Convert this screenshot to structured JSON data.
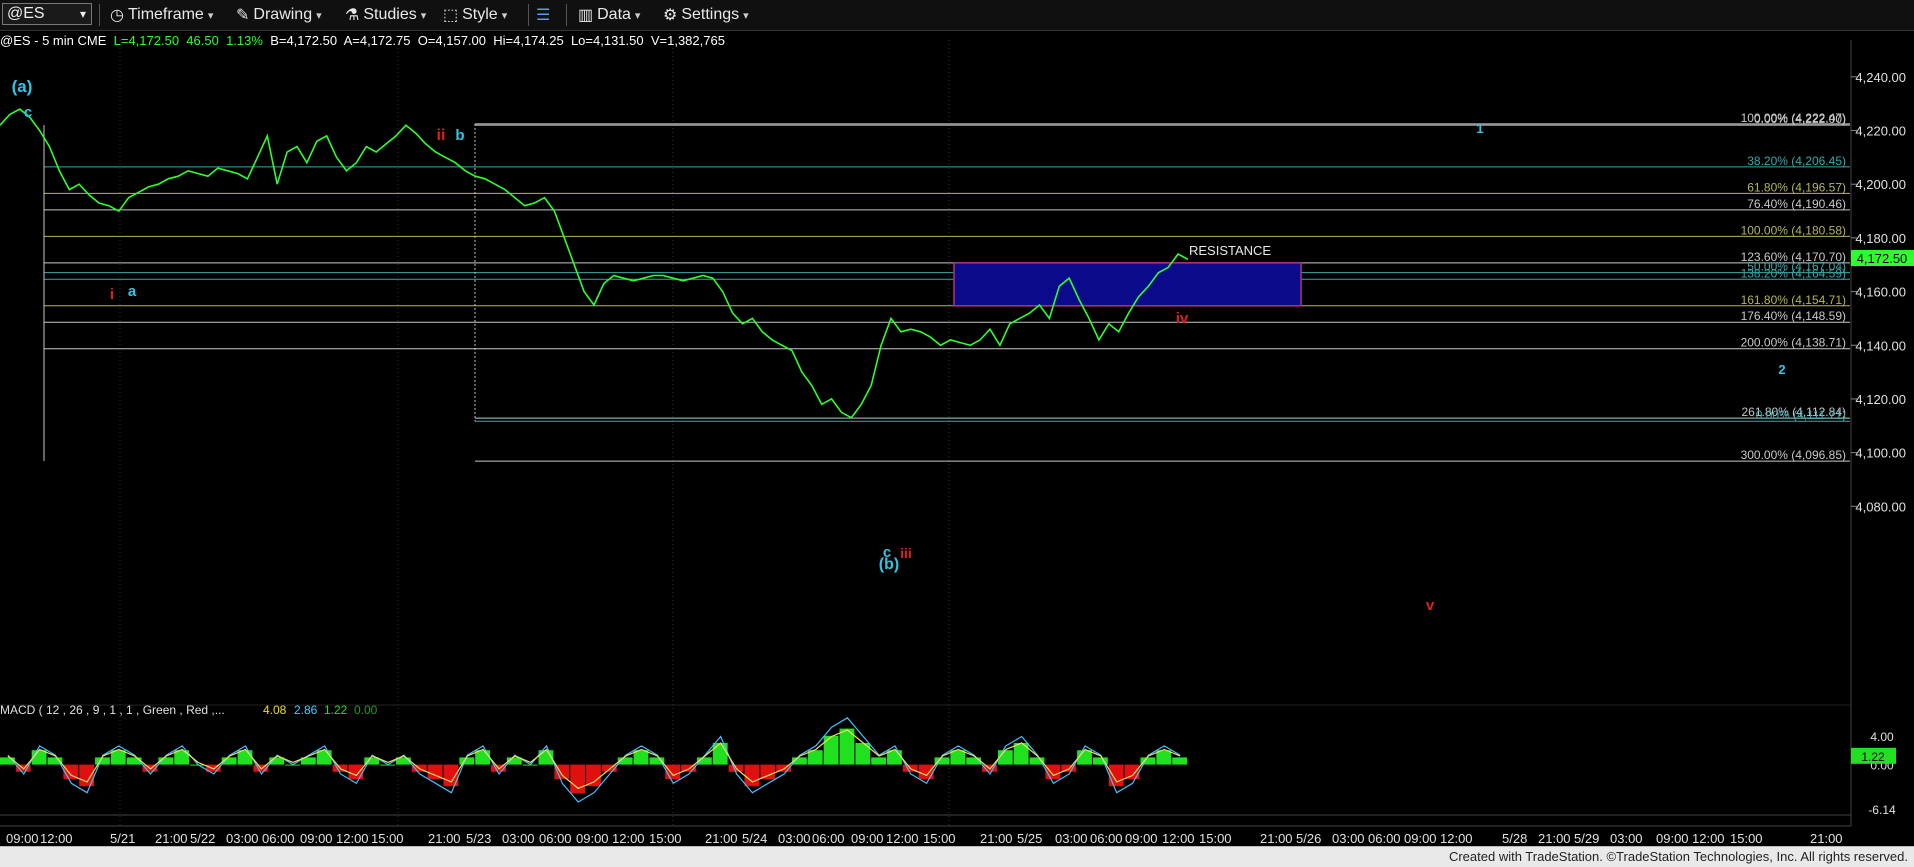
{
  "toolbar": {
    "symbol": "@ES",
    "timeframe": "Timeframe",
    "drawing": "Drawing",
    "studies": "Studies",
    "style": "Style",
    "data": "Data",
    "settings": "Settings"
  },
  "quote": {
    "symbol_line": "@ES - 5 min  CME",
    "last": "L=4,172.50",
    "change": "46.50",
    "pct": "1.13%",
    "bid": "B=4,172.50",
    "ask": "A=4,172.75",
    "open": "O=4,157.00",
    "high": "Hi=4,174.25",
    "low": "Lo=4,131.50",
    "volume": "V=1,382,765"
  },
  "macd_label": {
    "params": "MACD ( 12 , 26 , 9 , 1 , 1 , Green , Red ,...",
    "v1": "4.08",
    "v2": "2.86",
    "v3": "1.22",
    "v4": "0.00"
  },
  "footer": "Created with TradeStation. ©TradeStation Technologies, Inc. All rights reserved.",
  "colors": {
    "price": "#2dff2d",
    "red_label": "#e02020",
    "cyan_label": "#2fc6e8",
    "box_fill": "#0a0a8a",
    "box_border": "#b0327a",
    "macd_bars_pos": "#20e020",
    "macd_bars_neg": "#e01010",
    "last_price_tag": "#2dff2d"
  },
  "chart_data": {
    "type": "line",
    "title": "@ES - 5 min",
    "ylim": [
      4060,
      4250
    ],
    "yticks": [
      "4,240.00",
      "4,220.00",
      "4,200.00",
      "4,180.00",
      "4,160.00",
      "4,140.00",
      "4,120.00",
      "4,100.00",
      "4,080.00"
    ],
    "ytick_values": [
      4240,
      4220,
      4200,
      4180,
      4160,
      4140,
      4120,
      4100,
      4080
    ],
    "last_price": "4,172.50",
    "last_price_value": 4172.5,
    "xticks": [
      "09:00",
      "12:00",
      "5/21",
      "21:00",
      "5/22",
      "03:00",
      "06:00",
      "09:00",
      "12:00",
      "15:00",
      "21:00",
      "5/23",
      "03:00",
      "06:00",
      "09:00",
      "12:00",
      "15:00",
      "21:00",
      "5/24",
      "03:00",
      "06:00",
      "09:00",
      "12:00",
      "15:00",
      "21:00",
      "5/25",
      "03:00",
      "06:00",
      "09:00",
      "12:00",
      "15:00",
      "21:00",
      "5/26",
      "03:00",
      "06:00",
      "09:00",
      "12:00",
      "5/28",
      "21:00",
      "5/29",
      "03:00",
      "09:00",
      "12:00",
      "15:00",
      "21:00"
    ],
    "series": [
      {
        "values": [
          4222,
          4226,
          4228,
          4225,
          4220,
          4214,
          4205,
          4198,
          4200,
          4196,
          4193,
          4192,
          4190,
          4195,
          4197,
          4199,
          4200,
          4202,
          4203,
          4205,
          4204,
          4203,
          4206,
          4205,
          4204,
          4202,
          4210,
          4218,
          4200,
          4212,
          4214,
          4208,
          4216,
          4218,
          4210,
          4205,
          4208,
          4214,
          4212,
          4215,
          4218,
          4222,
          4219,
          4215,
          4212,
          4210,
          4208,
          4205,
          4203,
          4202,
          4200,
          4198,
          4195,
          4192,
          4193,
          4195,
          4190,
          4180,
          4170,
          4160,
          4155,
          4163,
          4166,
          4165,
          4164,
          4165,
          4166,
          4166,
          4165,
          4164,
          4165,
          4166,
          4165,
          4160,
          4152,
          4148,
          4150,
          4145,
          4142,
          4140,
          4138,
          4130,
          4125,
          4118,
          4120,
          4115,
          4113,
          4118,
          4125,
          4140,
          4150,
          4145,
          4146,
          4145,
          4143,
          4140,
          4142,
          4141,
          4140,
          4142,
          4146,
          4140,
          4148,
          4150,
          4152,
          4155,
          4150,
          4162,
          4165,
          4157,
          4150,
          4142,
          4148,
          4145,
          4152,
          4158,
          4162,
          4167,
          4169,
          4174,
          4172
        ]
      }
    ],
    "fib_levels": [
      {
        "label": "100.00% (4,222.47)",
        "value": 4222.47
      },
      {
        "label": "0.00% (4,222.00)",
        "value": 4222.0
      },
      {
        "label": "38.20% (4,206.45)",
        "value": 4206.45
      },
      {
        "label": "61.80% (4,196.57)",
        "value": 4196.57
      },
      {
        "label": "76.40% (4,190.46)",
        "value": 4190.46
      },
      {
        "label": "100.00% (4,180.58)",
        "value": 4180.58
      },
      {
        "label": "123.60% (4,170.70)",
        "value": 4170.7
      },
      {
        "label": "50.00% (4,167.04)",
        "value": 4167.04
      },
      {
        "label": "138.20% (4,164.59)",
        "value": 4164.59
      },
      {
        "label": "161.80% (4,154.71)",
        "value": 4154.71
      },
      {
        "label": "176.40% (4,148.59)",
        "value": 4148.59
      },
      {
        "label": "200.00% (4,138.71)",
        "value": 4138.71
      },
      {
        "label": "261.80% (4,112.84)",
        "value": 4112.84
      },
      {
        "label": "0.00% (4,111.71)",
        "value": 4111.71
      },
      {
        "label": "300.00% (4,096.85)",
        "value": 4096.85
      }
    ],
    "resistance_zone": {
      "label": "RESISTANCE",
      "low": 4154.7,
      "high": 4170.7
    },
    "wave_labels": [
      {
        "text": "(a)",
        "color": "cyan"
      },
      {
        "text": "c",
        "color": "cyan"
      },
      {
        "text": "i",
        "color": "red"
      },
      {
        "text": "a",
        "color": "cyan"
      },
      {
        "text": "ii",
        "color": "red"
      },
      {
        "text": "b",
        "color": "cyan"
      },
      {
        "text": "c",
        "color": "cyan"
      },
      {
        "text": "(b)",
        "color": "cyan"
      },
      {
        "text": "iii",
        "color": "red"
      },
      {
        "text": "iv",
        "color": "red"
      },
      {
        "text": "1",
        "color": "cyan"
      },
      {
        "text": "2",
        "color": "cyan"
      },
      {
        "text": "v",
        "color": "red"
      }
    ],
    "macd": {
      "yticks": [
        "4.00",
        "0.00",
        "-6.14"
      ],
      "ytick_values": [
        4.0,
        0.0,
        -6.14
      ],
      "current": "1.22",
      "current_value": 1.22,
      "hist": [
        1,
        -1,
        2,
        1,
        -2,
        -3,
        1,
        2,
        1,
        -1,
        1,
        2,
        0,
        -1,
        1,
        2,
        -1,
        1,
        0,
        1,
        2,
        -1,
        -2,
        1,
        0,
        1,
        -1,
        -2,
        -3,
        1,
        2,
        -1,
        1,
        0,
        2,
        -2,
        -4,
        -3,
        -1,
        1,
        2,
        1,
        -2,
        -1,
        1,
        3,
        -1,
        -3,
        -2,
        -1,
        1,
        2,
        4,
        5,
        3,
        1,
        2,
        -1,
        -2,
        1,
        2,
        1,
        -1,
        2,
        3,
        1,
        -2,
        -1,
        2,
        1,
        -3,
        -2,
        1,
        2,
        1
      ]
    },
    "grid": false
  }
}
